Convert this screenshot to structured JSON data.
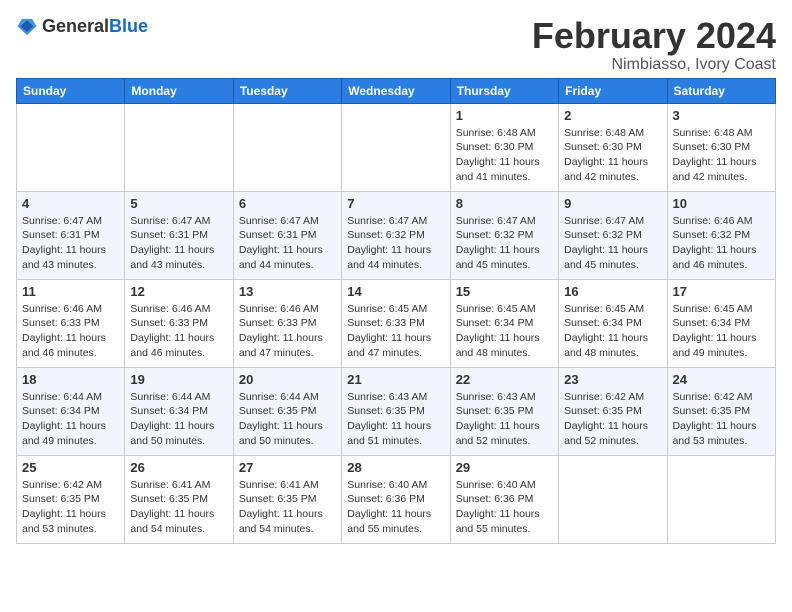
{
  "logo": {
    "text_general": "General",
    "text_blue": "Blue"
  },
  "title": "February 2024",
  "subtitle": "Nimbiasso, Ivory Coast",
  "days_of_week": [
    "Sunday",
    "Monday",
    "Tuesday",
    "Wednesday",
    "Thursday",
    "Friday",
    "Saturday"
  ],
  "weeks": [
    [
      {
        "num": "",
        "info": ""
      },
      {
        "num": "",
        "info": ""
      },
      {
        "num": "",
        "info": ""
      },
      {
        "num": "",
        "info": ""
      },
      {
        "num": "1",
        "info": "Sunrise: 6:48 AM\nSunset: 6:30 PM\nDaylight: 11 hours and 41 minutes."
      },
      {
        "num": "2",
        "info": "Sunrise: 6:48 AM\nSunset: 6:30 PM\nDaylight: 11 hours and 42 minutes."
      },
      {
        "num": "3",
        "info": "Sunrise: 6:48 AM\nSunset: 6:30 PM\nDaylight: 11 hours and 42 minutes."
      }
    ],
    [
      {
        "num": "4",
        "info": "Sunrise: 6:47 AM\nSunset: 6:31 PM\nDaylight: 11 hours and 43 minutes."
      },
      {
        "num": "5",
        "info": "Sunrise: 6:47 AM\nSunset: 6:31 PM\nDaylight: 11 hours and 43 minutes."
      },
      {
        "num": "6",
        "info": "Sunrise: 6:47 AM\nSunset: 6:31 PM\nDaylight: 11 hours and 44 minutes."
      },
      {
        "num": "7",
        "info": "Sunrise: 6:47 AM\nSunset: 6:32 PM\nDaylight: 11 hours and 44 minutes."
      },
      {
        "num": "8",
        "info": "Sunrise: 6:47 AM\nSunset: 6:32 PM\nDaylight: 11 hours and 45 minutes."
      },
      {
        "num": "9",
        "info": "Sunrise: 6:47 AM\nSunset: 6:32 PM\nDaylight: 11 hours and 45 minutes."
      },
      {
        "num": "10",
        "info": "Sunrise: 6:46 AM\nSunset: 6:32 PM\nDaylight: 11 hours and 46 minutes."
      }
    ],
    [
      {
        "num": "11",
        "info": "Sunrise: 6:46 AM\nSunset: 6:33 PM\nDaylight: 11 hours and 46 minutes."
      },
      {
        "num": "12",
        "info": "Sunrise: 6:46 AM\nSunset: 6:33 PM\nDaylight: 11 hours and 46 minutes."
      },
      {
        "num": "13",
        "info": "Sunrise: 6:46 AM\nSunset: 6:33 PM\nDaylight: 11 hours and 47 minutes."
      },
      {
        "num": "14",
        "info": "Sunrise: 6:45 AM\nSunset: 6:33 PM\nDaylight: 11 hours and 47 minutes."
      },
      {
        "num": "15",
        "info": "Sunrise: 6:45 AM\nSunset: 6:34 PM\nDaylight: 11 hours and 48 minutes."
      },
      {
        "num": "16",
        "info": "Sunrise: 6:45 AM\nSunset: 6:34 PM\nDaylight: 11 hours and 48 minutes."
      },
      {
        "num": "17",
        "info": "Sunrise: 6:45 AM\nSunset: 6:34 PM\nDaylight: 11 hours and 49 minutes."
      }
    ],
    [
      {
        "num": "18",
        "info": "Sunrise: 6:44 AM\nSunset: 6:34 PM\nDaylight: 11 hours and 49 minutes."
      },
      {
        "num": "19",
        "info": "Sunrise: 6:44 AM\nSunset: 6:34 PM\nDaylight: 11 hours and 50 minutes."
      },
      {
        "num": "20",
        "info": "Sunrise: 6:44 AM\nSunset: 6:35 PM\nDaylight: 11 hours and 50 minutes."
      },
      {
        "num": "21",
        "info": "Sunrise: 6:43 AM\nSunset: 6:35 PM\nDaylight: 11 hours and 51 minutes."
      },
      {
        "num": "22",
        "info": "Sunrise: 6:43 AM\nSunset: 6:35 PM\nDaylight: 11 hours and 52 minutes."
      },
      {
        "num": "23",
        "info": "Sunrise: 6:42 AM\nSunset: 6:35 PM\nDaylight: 11 hours and 52 minutes."
      },
      {
        "num": "24",
        "info": "Sunrise: 6:42 AM\nSunset: 6:35 PM\nDaylight: 11 hours and 53 minutes."
      }
    ],
    [
      {
        "num": "25",
        "info": "Sunrise: 6:42 AM\nSunset: 6:35 PM\nDaylight: 11 hours and 53 minutes."
      },
      {
        "num": "26",
        "info": "Sunrise: 6:41 AM\nSunset: 6:35 PM\nDaylight: 11 hours and 54 minutes."
      },
      {
        "num": "27",
        "info": "Sunrise: 6:41 AM\nSunset: 6:35 PM\nDaylight: 11 hours and 54 minutes."
      },
      {
        "num": "28",
        "info": "Sunrise: 6:40 AM\nSunset: 6:36 PM\nDaylight: 11 hours and 55 minutes."
      },
      {
        "num": "29",
        "info": "Sunrise: 6:40 AM\nSunset: 6:36 PM\nDaylight: 11 hours and 55 minutes."
      },
      {
        "num": "",
        "info": ""
      },
      {
        "num": "",
        "info": ""
      }
    ]
  ]
}
